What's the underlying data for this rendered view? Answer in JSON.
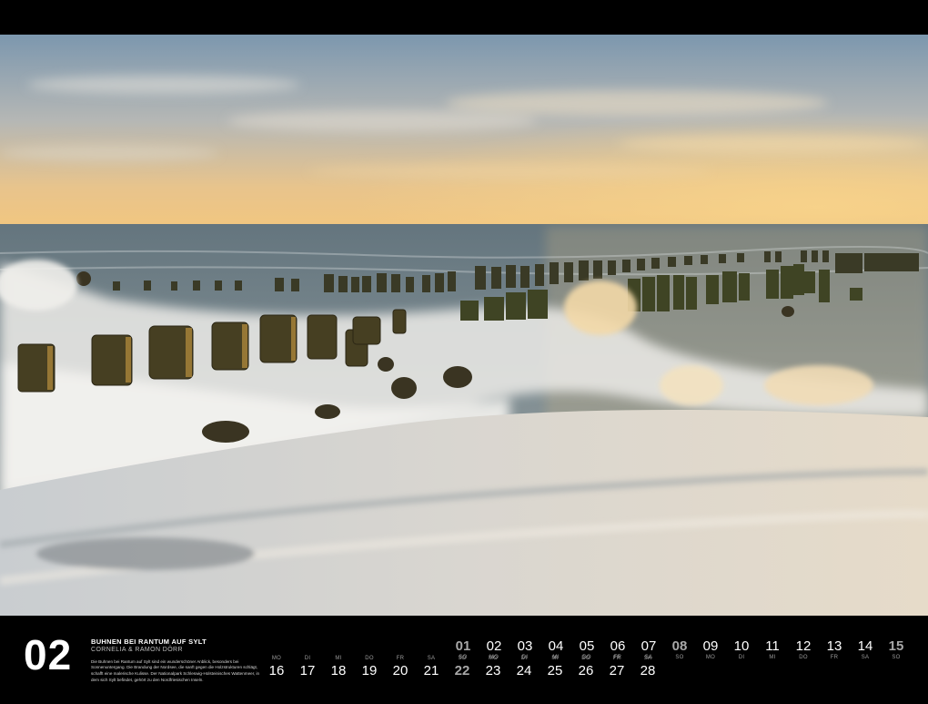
{
  "calendar": {
    "month_number": "02",
    "caption": {
      "title": "BUHNEN BEI RANTUM AUF SYLT",
      "author": "CORNELIA & RAMON DÖRR",
      "description": "Die Buhnen bei Rantum auf Sylt sind ein wunderschöner Anblick, besonders bei Sonnenuntergang. Die Brandung der Nordsee, die sanft gegen die Holzstrukturen schlägt, schafft eine malerische Kulisse. Der Nationalpark Schleswig-Holsteinisches Wattenmeer, in dem sich Sylt befindet, gehört zu den Nordfriesischen Inseln."
    },
    "days_row1": [
      {
        "num": "01",
        "wd": "SO",
        "type": "sunday"
      },
      {
        "num": "02",
        "wd": "MO",
        "type": "weekday"
      },
      {
        "num": "03",
        "wd": "DI",
        "type": "weekday"
      },
      {
        "num": "04",
        "wd": "MI",
        "type": "weekday"
      },
      {
        "num": "05",
        "wd": "DO",
        "type": "weekday"
      },
      {
        "num": "06",
        "wd": "FR",
        "type": "weekday"
      },
      {
        "num": "07",
        "wd": "SA",
        "type": "weekday"
      },
      {
        "num": "08",
        "wd": "SO",
        "type": "sunday"
      },
      {
        "num": "09",
        "wd": "MO",
        "type": "weekday"
      },
      {
        "num": "10",
        "wd": "DI",
        "type": "weekday"
      },
      {
        "num": "11",
        "wd": "MI",
        "type": "weekday"
      },
      {
        "num": "12",
        "wd": "DO",
        "type": "weekday"
      },
      {
        "num": "13",
        "wd": "FR",
        "type": "weekday"
      },
      {
        "num": "14",
        "wd": "SA",
        "type": "weekday"
      },
      {
        "num": "15",
        "wd": "SO",
        "type": "sunday"
      }
    ],
    "days_row2": [
      {
        "num": "16",
        "wd": "MO",
        "type": "weekday"
      },
      {
        "num": "17",
        "wd": "DI",
        "type": "weekday"
      },
      {
        "num": "18",
        "wd": "MI",
        "type": "weekday"
      },
      {
        "num": "19",
        "wd": "DO",
        "type": "weekday"
      },
      {
        "num": "20",
        "wd": "FR",
        "type": "weekday"
      },
      {
        "num": "21",
        "wd": "SA",
        "type": "weekday"
      },
      {
        "num": "22",
        "wd": "SO",
        "type": "sunday"
      },
      {
        "num": "23",
        "wd": "MO",
        "type": "weekday"
      },
      {
        "num": "24",
        "wd": "DI",
        "type": "weekday"
      },
      {
        "num": "25",
        "wd": "MI",
        "type": "weekday"
      },
      {
        "num": "26",
        "wd": "DO",
        "type": "weekday"
      },
      {
        "num": "27",
        "wd": "FR",
        "type": "weekday"
      },
      {
        "num": "28",
        "wd": "SA",
        "type": "weekday"
      }
    ]
  },
  "colors": {
    "background": "#000000",
    "sky_top": "#7f9bb3",
    "sky_horizon": "#f2c27a",
    "sea": "#5d7079",
    "foam": "#e9e6e1",
    "weekend_text": "#a8a8a8"
  }
}
